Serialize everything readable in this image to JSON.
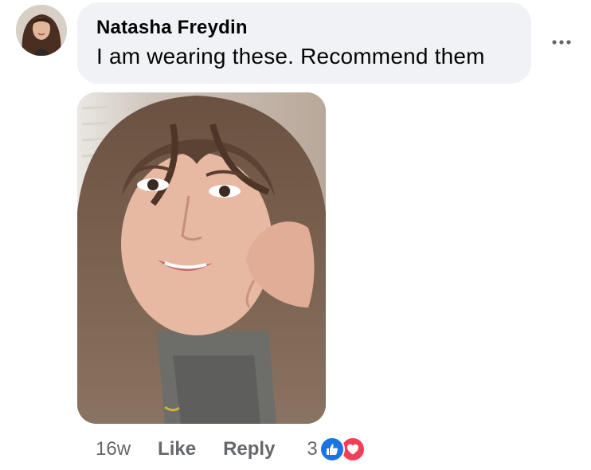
{
  "comment": {
    "author": "Natasha Freydin",
    "text": "I am wearing these. Recommend them",
    "time": "16w",
    "like_label": "Like",
    "reply_label": "Reply",
    "reaction_count": "3",
    "reactions": [
      "like",
      "love"
    ]
  },
  "icons": {
    "more": "more-horizontal-icon",
    "like": "thumbs-up-icon",
    "love": "heart-icon"
  },
  "colors": {
    "bubble": "#f0f2f5",
    "secondary_text": "#65676b",
    "like_blue": "#1b74e4",
    "love_red": "#f33e58"
  }
}
